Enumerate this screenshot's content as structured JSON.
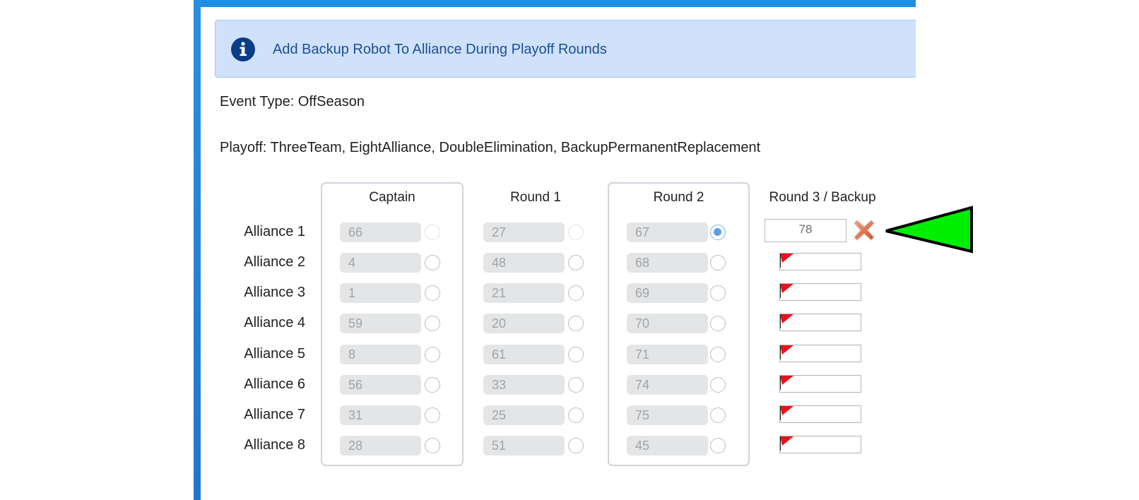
{
  "banner": {
    "text": "Add Backup Robot To Alliance During Playoff Rounds",
    "icon": "info-icon"
  },
  "event_type": "Event Type: OffSeason",
  "playoff": "Playoff: ThreeTeam, EightAlliance, DoubleElimination, BackupPermanentReplacement",
  "columns": {
    "captain": "Captain",
    "round1": "Round 1",
    "round2": "Round 2",
    "round3": "Round 3 / Backup"
  },
  "alliances": [
    {
      "label": "Alliance 1",
      "captain": "66",
      "round1": "27",
      "round2": "67"
    },
    {
      "label": "Alliance 2",
      "captain": "4",
      "round1": "48",
      "round2": "68"
    },
    {
      "label": "Alliance 3",
      "captain": "1",
      "round1": "21",
      "round2": "69"
    },
    {
      "label": "Alliance 4",
      "captain": "59",
      "round1": "20",
      "round2": "70"
    },
    {
      "label": "Alliance 5",
      "captain": "8",
      "round1": "61",
      "round2": "71"
    },
    {
      "label": "Alliance 6",
      "captain": "56",
      "round1": "33",
      "round2": "74"
    },
    {
      "label": "Alliance 7",
      "captain": "31",
      "round1": "25",
      "round2": "75"
    },
    {
      "label": "Alliance 8",
      "captain": "28",
      "round1": "51",
      "round2": "45"
    }
  ],
  "backup": {
    "alliance1_value": "78",
    "clear_icon": "clear-x-icon",
    "empty_flag_icon": "red-flag-icon"
  },
  "annotation": {
    "arrow_color": "#00ee00",
    "arrow_icon": "green-pointer-arrow"
  }
}
